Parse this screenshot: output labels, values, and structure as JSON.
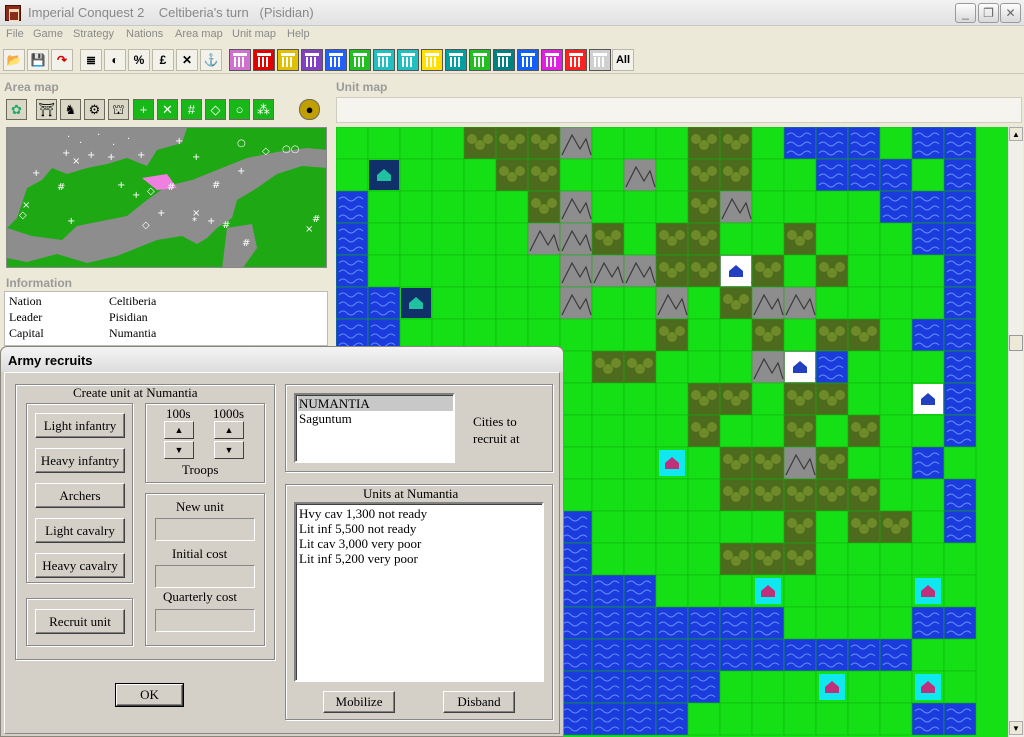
{
  "window": {
    "title": "Imperial Conquest 2    Celtiberia's turn   (Pisidian)",
    "minimize": "_",
    "maximize": "❐",
    "close": "✕"
  },
  "menu": [
    "File",
    "Game",
    "Strategy",
    "Nations",
    "Area map",
    "Unit map",
    "Help"
  ],
  "toolbar": {
    "tools": [
      "📂",
      "💾",
      "↷",
      "≣",
      "◐",
      "%",
      "£",
      "✕",
      "⚓"
    ],
    "nation_colors": [
      "#d070d0",
      "#e00000",
      "#e0c000",
      "#8040c0",
      "#2060ff",
      "#20c020",
      "#20c0c0",
      "#20c0c0",
      "#ffe000",
      "#00a0a0",
      "#20c020",
      "#008080",
      "#1060ff",
      "#e020e0",
      "#ff2020",
      "#d0d0d0"
    ],
    "all_label": "All"
  },
  "area_map": {
    "header": "Area map",
    "tools": [
      "✿",
      "⛩",
      "♞",
      "⚙",
      "⛫",
      "+",
      "✕",
      "#",
      "◇",
      "○",
      "⁂",
      "●"
    ]
  },
  "information": {
    "header": "Information",
    "rows": [
      {
        "key": "Nation",
        "value": "Celtiberia"
      },
      {
        "key": "Leader",
        "value": "Pisidian"
      },
      {
        "key": "Capital",
        "value": "Numantia"
      }
    ]
  },
  "unit_map": {
    "header": "Unit map",
    "colors": {
      "grass": "#15e015",
      "water": "#1a3cdc",
      "forest": "#4d6b1c",
      "mountain": "#8d8d8d",
      "city_cyan": "#10e8f0",
      "city_white": "#ffffff",
      "city_dark": "#10306a"
    }
  },
  "dialog": {
    "title": "Army recruits",
    "create_group_label": "Create unit at Numantia",
    "unit_buttons": [
      "Light infantry",
      "Heavy infantry",
      "Archers",
      "Light cavalry",
      "Heavy cavalry"
    ],
    "hundreds_label": "100s",
    "thousands_label": "1000s",
    "troops_label": "Troops",
    "new_unit_label": "New unit",
    "initial_cost_label": "Initial cost",
    "quarterly_cost_label": "Quarterly cost",
    "recruit_button": "Recruit unit",
    "ok_button": "OK",
    "cities": [
      "NUMANTIA",
      "Saguntum"
    ],
    "cities_label": "Cities to recruit at",
    "units_group_label": "Units at Numantia",
    "units": [
      "Hvy cav  1,300  not ready",
      "Lit inf  5,500  not ready",
      "Lit cav  3,000  very poor",
      "Lit inf  5,200  very poor"
    ],
    "mobilize_button": "Mobilize",
    "disband_button": "Disband"
  }
}
